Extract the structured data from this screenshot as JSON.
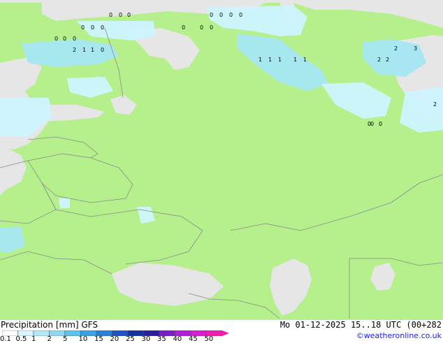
{
  "map": {
    "colors": {
      "water": "#e6e6e6",
      "land": "#b5f08c",
      "border": "#8a8a8a",
      "precip_light": "#cff5ff",
      "precip_mid": "#a7e8f5",
      "precip_strong": "#82d8f0"
    }
  },
  "precip_numbers": [
    "0",
    "0",
    "0",
    "0",
    "0",
    "0",
    "0",
    "0",
    "0",
    "0",
    "0",
    "0",
    "0",
    "0",
    "0",
    "0",
    "1",
    "2",
    "3",
    "2",
    "1",
    "0",
    "1",
    "1",
    "1",
    "1",
    "1",
    "0",
    "0",
    "2",
    "2",
    "0",
    "2"
  ],
  "footer": {
    "legend_title": "Precipitation [mm]  GFS",
    "model_time": "Mo 01-12-2025 15..18 UTC (00+282",
    "copyright": "©weatheronline.co.uk",
    "scale_ticks": [
      "0.1",
      "0.5",
      "1",
      "2",
      "5",
      "10",
      "15",
      "20",
      "25",
      "30",
      "35",
      "40",
      "45",
      "50"
    ],
    "scale_colors": [
      "#ffffff",
      "#d8f6ff",
      "#b0eaf8",
      "#8ed8f4",
      "#5fc2ee",
      "#3aa2e2",
      "#2a7fd6",
      "#1d55c8",
      "#14329e",
      "#2a1f9a",
      "#7a1fc8",
      "#b01fd8",
      "#d81fd0",
      "#f01fb0"
    ]
  }
}
